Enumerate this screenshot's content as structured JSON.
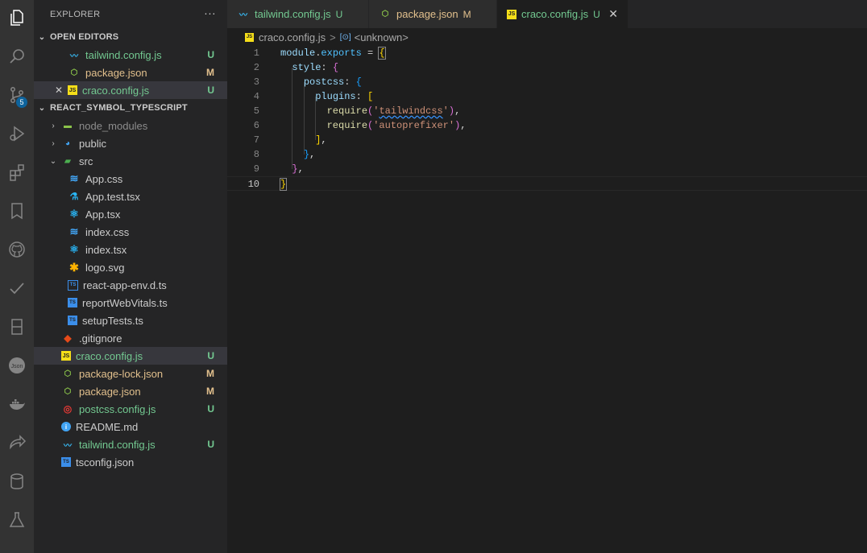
{
  "activity_bar": {
    "items": [
      {
        "icon": "files-icon"
      },
      {
        "icon": "search-icon"
      },
      {
        "icon": "source-control-icon",
        "badge": "5"
      },
      {
        "icon": "run-debug-icon"
      },
      {
        "icon": "extensions-icon"
      },
      {
        "icon": "bookmark-icon"
      },
      {
        "icon": "github-icon"
      },
      {
        "icon": "checkmark-icon"
      },
      {
        "icon": "book-icon"
      },
      {
        "icon": "json-icon"
      },
      {
        "icon": "docker-icon"
      },
      {
        "icon": "remote-share-icon"
      },
      {
        "icon": "database-icon"
      },
      {
        "icon": "testing-flask-icon"
      }
    ]
  },
  "sidebar": {
    "title": "EXPLORER",
    "more": "···",
    "open_editors": {
      "label": "OPEN EDITORS",
      "items": [
        {
          "name": "tailwind.config.js",
          "status": "U"
        },
        {
          "name": "package.json",
          "status": "M"
        },
        {
          "name": "craco.config.js",
          "status": "U",
          "close": "✕"
        }
      ]
    },
    "project": {
      "label": "REACT_SYMBOL_TYPESCRIPT",
      "folders": [
        {
          "name": "node_modules"
        },
        {
          "name": "public"
        },
        {
          "name": "src"
        }
      ],
      "src_files": [
        {
          "name": "App.css"
        },
        {
          "name": "App.test.tsx"
        },
        {
          "name": "App.tsx"
        },
        {
          "name": "index.css"
        },
        {
          "name": "index.tsx"
        },
        {
          "name": "logo.svg"
        },
        {
          "name": "react-app-env.d.ts"
        },
        {
          "name": "reportWebVitals.ts"
        },
        {
          "name": "setupTests.ts"
        }
      ],
      "root_files": [
        {
          "name": ".gitignore",
          "status": ""
        },
        {
          "name": "craco.config.js",
          "status": "U"
        },
        {
          "name": "package-lock.json",
          "status": "M"
        },
        {
          "name": "package.json",
          "status": "M"
        },
        {
          "name": "postcss.config.js",
          "status": "U"
        },
        {
          "name": "README.md",
          "status": ""
        },
        {
          "name": "tailwind.config.js",
          "status": "U"
        },
        {
          "name": "tsconfig.json",
          "status": ""
        }
      ]
    }
  },
  "tabs": [
    {
      "label": "tailwind.config.js",
      "status": "U"
    },
    {
      "label": "package.json",
      "status": "M"
    },
    {
      "label": "craco.config.js",
      "status": "U",
      "close": "✕"
    }
  ],
  "breadcrumb": {
    "file": "craco.config.js",
    "separator": ">",
    "symbol": "<unknown>"
  },
  "editor": {
    "line_numbers": [
      "1",
      "2",
      "3",
      "4",
      "5",
      "6",
      "7",
      "8",
      "9",
      "10"
    ],
    "tokens": {
      "module": "module",
      "dot": ".",
      "exports": "exports",
      "eq": " = ",
      "brace_open": "{",
      "style": "style",
      "postcss": "postcss",
      "plugins": "plugins",
      "colon": ": ",
      "bracket_open": "[",
      "require": "require",
      "paren_open": "(",
      "str_tailwind": "'tailwindcss'",
      "str_autoprefixer": "'autoprefixer'",
      "paren_close_comma": "),",
      "bracket_close": "]",
      "comma": ",",
      "brace_close": "}"
    }
  },
  "colors": {
    "untracked": "#73c991",
    "modified": "#e2c08d",
    "badge": "#0e639c"
  }
}
